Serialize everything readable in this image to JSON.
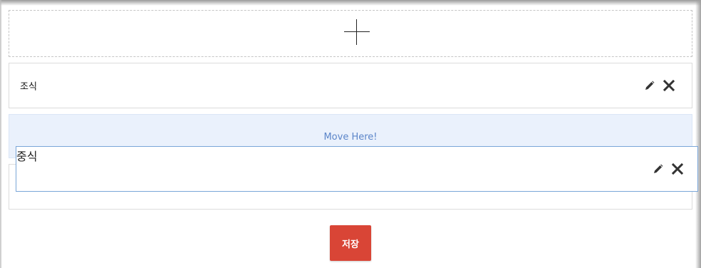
{
  "add_zone": {
    "icon": "plus-icon"
  },
  "items": [
    {
      "label": "조식",
      "edit_icon": "pencil-icon",
      "delete_icon": "close-icon"
    },
    {
      "label": "중식",
      "edit_icon": "pencil-icon",
      "delete_icon": "close-icon"
    }
  ],
  "drop_zone": {
    "text": "Move Here!"
  },
  "save_button": {
    "label": "저장",
    "color": "#d94536"
  },
  "colors": {
    "drop_zone_bg": "#eaf1fc",
    "drop_zone_text": "#5b85c9",
    "drag_border": "#7aa6d8"
  }
}
